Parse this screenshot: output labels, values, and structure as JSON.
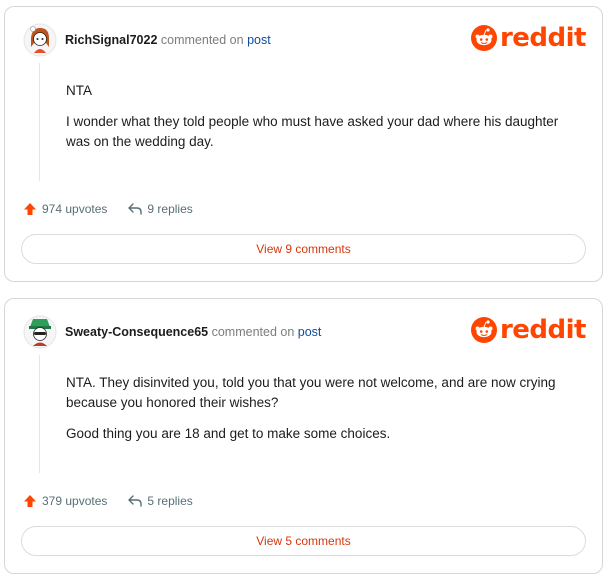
{
  "brand": {
    "name": "reddit",
    "color": "#ff4500"
  },
  "comments": [
    {
      "username": "RichSignal7022",
      "action": "commented on",
      "target": "post",
      "avatar": "reddit-avatar-girl-icon",
      "paragraphs": [
        "NTA",
        "I wonder what they told people who must have asked your dad where his daughter was on the wedding day."
      ],
      "upvotes": "974 upvotes",
      "replies": "9 replies",
      "view_label": "View 9 comments"
    },
    {
      "username": "Sweaty-Consequence65",
      "action": "commented on",
      "target": "post",
      "avatar": "reddit-avatar-green-hat-icon",
      "paragraphs": [
        "NTA. They disinvited you, told you that you were not welcome, and are now crying because you honored their wishes?",
        "Good thing you are 18 and get to make some choices."
      ],
      "upvotes": "379 upvotes",
      "replies": "5 replies",
      "view_label": "View 5 comments"
    }
  ]
}
